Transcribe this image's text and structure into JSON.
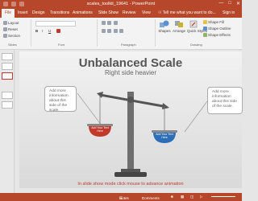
{
  "window": {
    "title": "scales_toolkit_19641 - PowerPoint",
    "controls": [
      "—",
      "□",
      "✕"
    ]
  },
  "tabs": [
    {
      "label": "File"
    },
    {
      "label": "Insert"
    },
    {
      "label": "Design"
    },
    {
      "label": "Transitions"
    },
    {
      "label": "Animations"
    },
    {
      "label": "Slide Show"
    },
    {
      "label": "Review"
    },
    {
      "label": "View"
    }
  ],
  "active_tab_index": 0,
  "tell_me": "Tell me what you want to do...",
  "sign_in": "Sign in",
  "ribbon": {
    "slides_group": {
      "layout": "Layout",
      "reset": "Reset",
      "section": "Section",
      "label": "Slides"
    },
    "font_group": {
      "label": "Font",
      "bold": "B",
      "italic": "I",
      "underline": "U"
    },
    "paragraph_group": {
      "label": "Paragraph"
    },
    "drawing_group": {
      "shapes": "Shapes",
      "arrange": "Arrange",
      "quick_styles": "Quick Styles",
      "shape_fill": "Shape Fill",
      "shape_outline": "Shape Outline",
      "shape_effects": "Shape Effects",
      "label": "Drawing"
    }
  },
  "slide": {
    "title": "Unbalanced Scale",
    "subtitle": "Right side heavier",
    "callout_left": "Add more information about this side of the scale.",
    "callout_right": "Add more information about this side of the scale.",
    "left_pan_text": "Add Your Text Here",
    "right_pan_text": "Add Your Text Here",
    "footer_note": "In slide show mode click mouse to advance animation"
  },
  "status": {
    "notes": "Notes",
    "comments": "Comments"
  },
  "colors": {
    "accent": "#b7472a",
    "left_pan": "#c0392b",
    "right_pan": "#2d6fb7"
  }
}
